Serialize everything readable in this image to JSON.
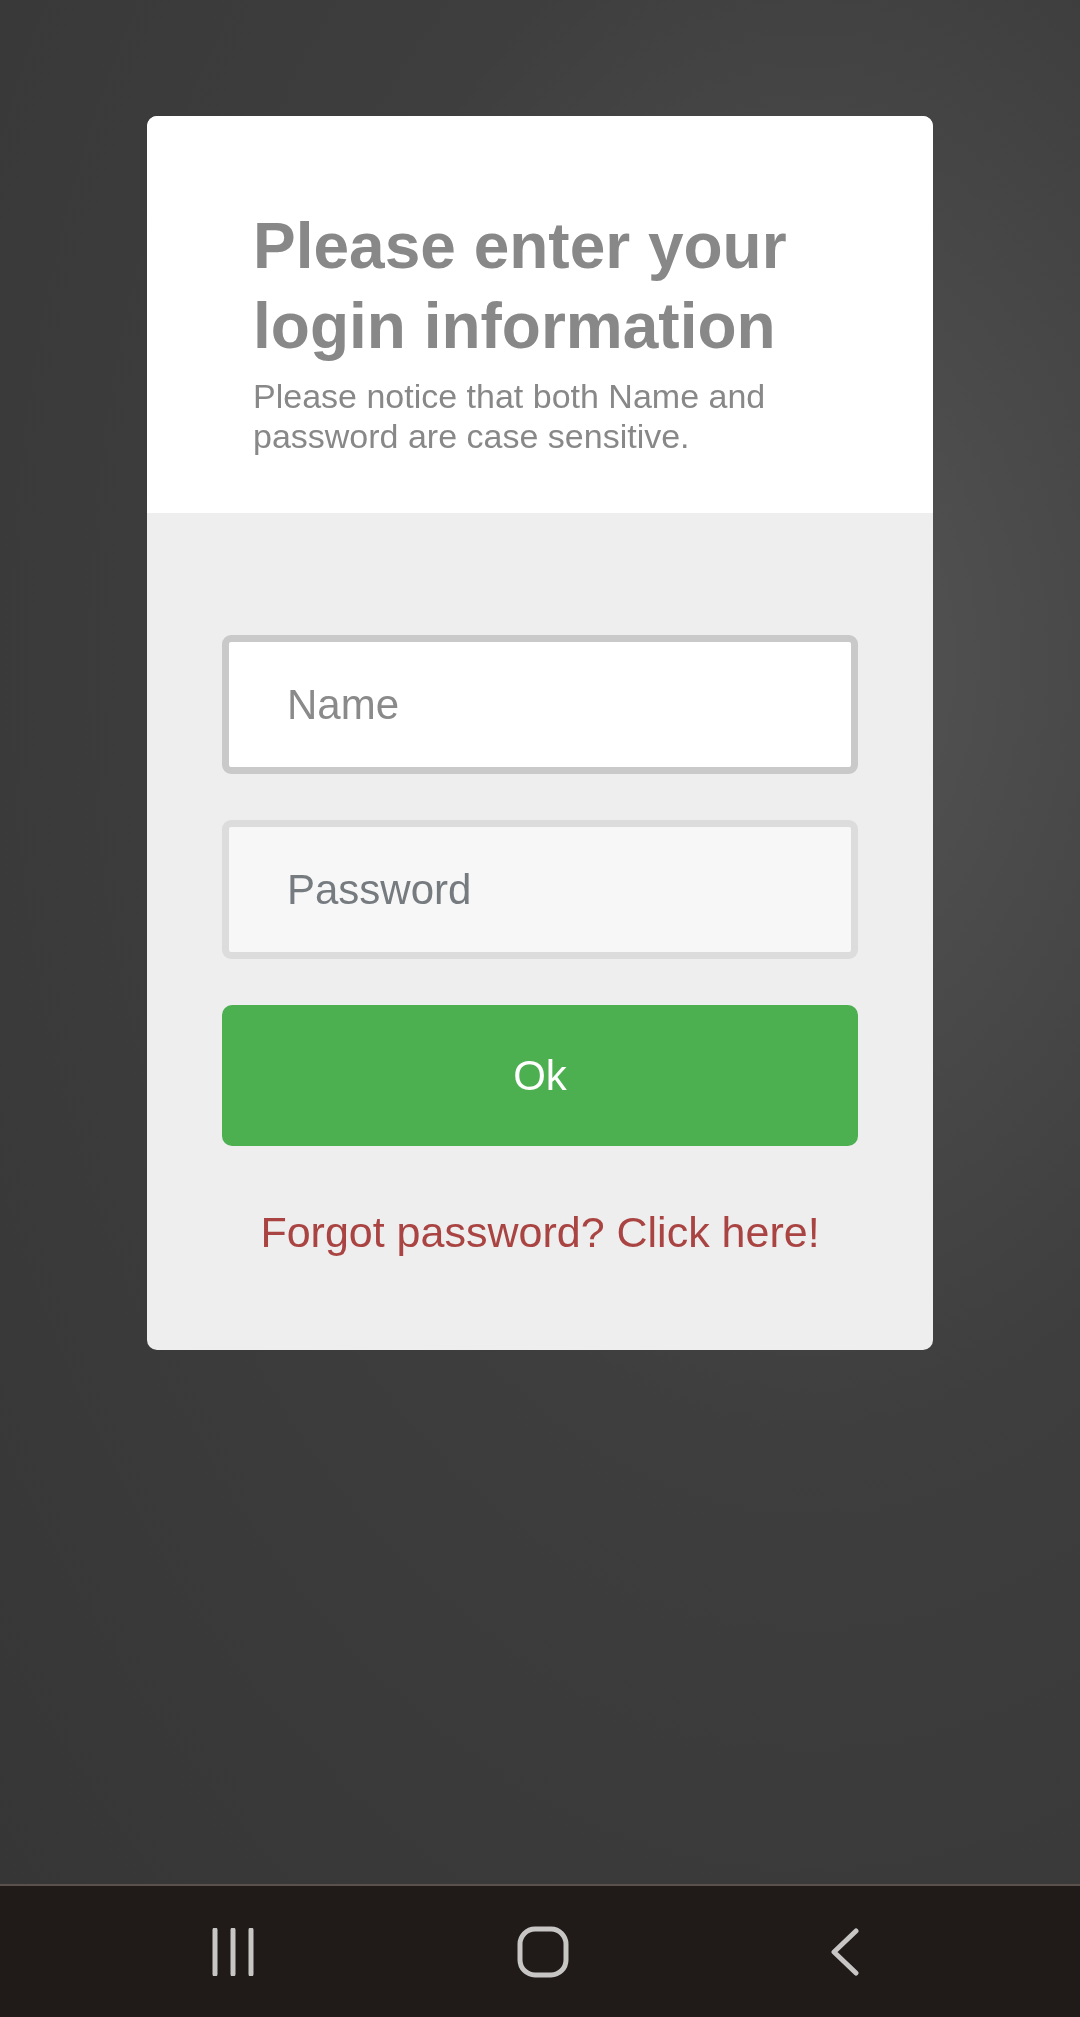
{
  "dialog": {
    "title": "Please enter your login information",
    "subtitle": "Please notice that both Name and password are case sensitive."
  },
  "fields": [
    {
      "placeholder": "Name",
      "focused": true
    },
    {
      "placeholder": "Password",
      "focused": false
    }
  ],
  "submit_button": {
    "label": "Ok"
  },
  "forgot_link": {
    "label": "Forgot password? Click here!"
  }
}
